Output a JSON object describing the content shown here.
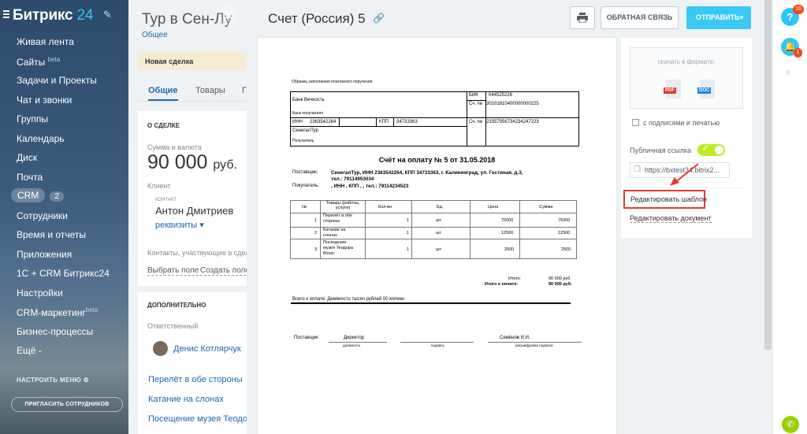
{
  "sidebar": {
    "logo_main": "Битрикс",
    "logo_num": "24",
    "items": [
      {
        "label": "Живая лента"
      },
      {
        "label": "Сайты",
        "sup": "beta"
      },
      {
        "label": "Задачи и Проекты"
      },
      {
        "label": "Чат и звонки"
      },
      {
        "label": "Группы"
      },
      {
        "label": "Календарь"
      },
      {
        "label": "Диск"
      },
      {
        "label": "Почта"
      },
      {
        "label": "CRM",
        "count": "2"
      },
      {
        "label": "Сотрудники"
      },
      {
        "label": "Время и отчеты"
      },
      {
        "label": "Приложения"
      },
      {
        "label": "1С + CRM Битрикс24"
      },
      {
        "label": "Настройки"
      },
      {
        "label": "CRM-маркетинг",
        "sup": "beta"
      },
      {
        "label": "Бизнес-процессы"
      },
      {
        "label": "Ещё -"
      }
    ],
    "tune_label": "НАСТРОИТЬ МЕНЮ",
    "invite_label": "ПРИГЛАСИТЬ СОТРУДНИКОВ"
  },
  "deal": {
    "title": "Тур в Сен-Лу",
    "category": "Общее",
    "stage": "Новая сделка",
    "tabs": [
      "Общие",
      "Товары",
      "П"
    ],
    "section_about": "О СДЕЛКЕ",
    "sum_label": "Сумма и валюта",
    "sum_value": "90 000",
    "sum_currency": "руб.",
    "client_label": "Клиент",
    "contact_label": "КОНТАКТ",
    "client_name": "Антон Дмитриев",
    "client_req": "реквизиты",
    "participants": "Контакты, участвующие в сделке",
    "choose_field": "Выбрать поле",
    "create_field": "Создать поле",
    "section_extra": "ДОПОЛНИТЕЛЬНО",
    "responsible_label": "Ответственный",
    "responsible_name": "Денис Котлярчук",
    "products": [
      "Перелёт в обе стороны",
      "Катание на слонах",
      "Посещение музея Теодора М"
    ]
  },
  "slider": {
    "title": "Счет (Россия) 5",
    "feedback_label": "ОБРАТНАЯ СВЯЗЬ",
    "send_label": "ОТПРАВИТЬ",
    "download_label": "скачать в формате:",
    "pdf_label": "PDF",
    "doc_label": "DOC",
    "signature_label": "с подписями и печатью",
    "public_link_label": "Публичная ссылка",
    "public_url": "https://bxtest34.bitrix2...",
    "edit_template": "Редактировать шаблон",
    "edit_document": "Редактировать документ"
  },
  "invoice": {
    "sample_note": "Образец заполнения платежного поручения",
    "bank_name": "Банк Вечность",
    "bank_recipient": "Банк получателя",
    "bik_label": "БИК",
    "bik_value": "044525226",
    "acc_label": "Сч. №",
    "acc_value": "30101810400000000225",
    "inn_label": "ИНН",
    "inn_value": "2363542264",
    "kpp_label": "КПП",
    "kpp_value": "34733363",
    "acc2_label": "Сч. №",
    "acc2_value": "23357956734234247223",
    "seller": "СенегалТур",
    "recipient_label": "Получатель",
    "title": "Счёт на оплату № 5 от 31.05.2018",
    "supplier_label": "Поставщик:",
    "supplier_line1": "СенегалТур, ИНН 2363542264, КПП 34733363, г. Калининград, ул. Гостиная, д.3,",
    "supplier_line2": "тел.: 79114953034",
    "buyer_label": "Покупатель:",
    "buyer_value": ", ИНН , КПП , , тел.: 79114234523",
    "columns": [
      "№",
      "Товары (работы, услуги)",
      "Кол-во",
      "Ед.",
      "Цена",
      "Сумма"
    ],
    "rows": [
      {
        "n": "1",
        "name1": "Перелёт в обе",
        "name2": "стороны",
        "name3": "",
        "qty": "1",
        "unit": "шт",
        "price": "75000",
        "sum": "75000"
      },
      {
        "n": "2",
        "name1": "Катание на",
        "name2": "слонах",
        "name3": "",
        "qty": "1",
        "unit": "шт",
        "price": "12500",
        "sum": "12500"
      },
      {
        "n": "3",
        "name1": "Посещение",
        "name2": "музея Теодора",
        "name3": "Моно",
        "qty": "1",
        "unit": "шт",
        "price": "2500",
        "sum": "2500"
      }
    ],
    "total_label": "Итого:",
    "total_value": "90 000 руб.",
    "pay_label": "Итого к оплате:",
    "pay_value": "90 000 руб.",
    "in_words": "Всего к оплате: Девяносто тысяч рублей 00 копеек",
    "sign_supplier": "Поставщик",
    "sign_role": "Директор",
    "sign_name": "Семёнов И.И.",
    "sign_caption1": "должность",
    "sign_caption2": "подпись",
    "sign_caption3": "расшифровка подписи"
  },
  "rightbar": {
    "help_badge": "10",
    "bell_badge": "1"
  }
}
